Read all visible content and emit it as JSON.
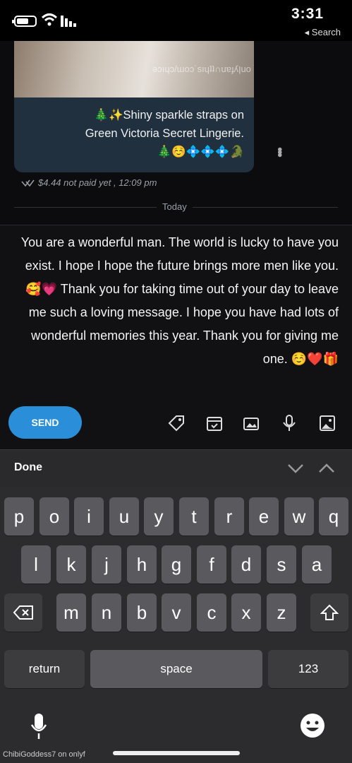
{
  "status_bar": {
    "time": "3:31",
    "back_label": "◂ Search"
  },
  "chat": {
    "watermark": "ǝɔıɥɔ/ɯoɔ˙sıɥʇʇ∩uɐɟʎןuo ∀",
    "caption_line1": "🎄✨Shiny sparkle straps on",
    "caption_line2": "Green Victoria Secret Lingerie.",
    "caption_line3": "🎄☺️💠💠💠🐊",
    "meta": "$4.44 not paid yet , 12:09 pm",
    "day_divider": "Today",
    "more_icon": "more-vertical-icon"
  },
  "compose": {
    "message": "You are a wonderful man. The world is lucky to have you exist. I hope I hope the future brings more men like you. 🥰💗 Thank you for taking time out of your day to leave me such a loving message. I hope you have had lots of wonderful memories this year. Thank you for giving me one. ☺️❤️🎁",
    "send_label": "SEND",
    "tools": [
      "image-icon",
      "mic-icon",
      "gallery-icon",
      "calendar-icon",
      "tag-icon"
    ]
  },
  "keyboard_bar": {
    "done_label": "Done"
  },
  "keyboard": {
    "row1": [
      "w",
      "e",
      "r",
      "t",
      "y",
      "u",
      "i",
      "o",
      "p"
    ],
    "row1_first": "q",
    "row2": [
      "a",
      "s",
      "d",
      "f",
      "g",
      "h",
      "j",
      "k",
      "l"
    ],
    "row3": [
      "z",
      "x",
      "c",
      "v",
      "b",
      "n",
      "m"
    ],
    "numbers_label": "123",
    "space_label": "space",
    "return_label": "return"
  },
  "bottom_hint": "ChibiGoddess7 on onlyf"
}
